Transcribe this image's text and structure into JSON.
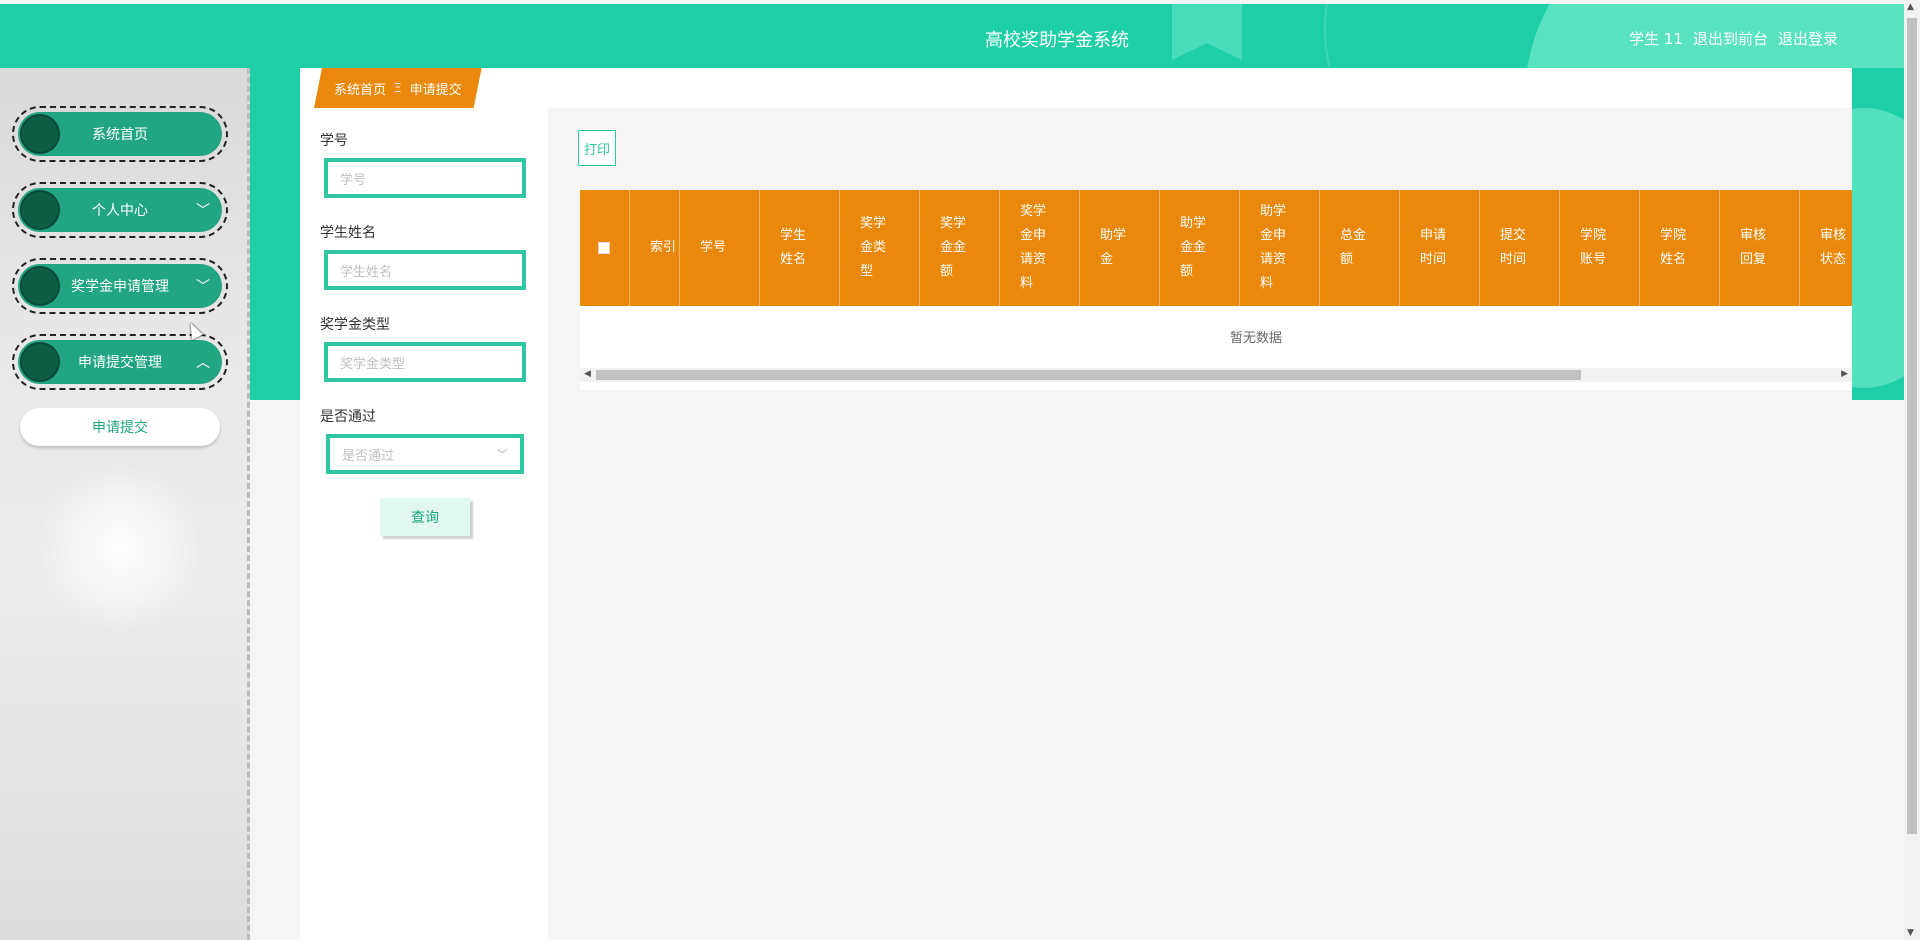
{
  "header": {
    "title": "高校奖助学金系统",
    "user": "学生 11",
    "to_front": "退出到前台",
    "logout": "退出登录"
  },
  "sidebar": {
    "items": [
      {
        "label": "系统首页"
      },
      {
        "label": "个人中心"
      },
      {
        "label": "奖学金申请管理"
      },
      {
        "label": "申请提交管理"
      }
    ],
    "sub_item": "申请提交"
  },
  "breadcrumb": {
    "home": "系统首页",
    "separator": "Ξ",
    "current": "申请提交"
  },
  "search": {
    "fields": [
      {
        "label": "学号",
        "placeholder": "学号"
      },
      {
        "label": "学生姓名",
        "placeholder": "学生姓名"
      },
      {
        "label": "奖学金类型",
        "placeholder": "奖学金类型"
      },
      {
        "label": "是否通过",
        "placeholder": "是否通过"
      }
    ],
    "button": "查询"
  },
  "toolbar": {
    "print": "打印"
  },
  "table": {
    "columns": [
      "索引",
      "学号",
      "学生姓名",
      "奖学金类型",
      "奖学金金额",
      "奖学金申请资料",
      "助学金",
      "助学金金额",
      "助学金申请资料",
      "总金额",
      "申请时间",
      "提交时间",
      "学院账号",
      "学院姓名",
      "审核回复",
      "审核状态"
    ],
    "empty_text": "暂无数据"
  },
  "colors": {
    "primary": "#1ecfa5",
    "accent": "#e9880a",
    "menu": "#21a582"
  }
}
